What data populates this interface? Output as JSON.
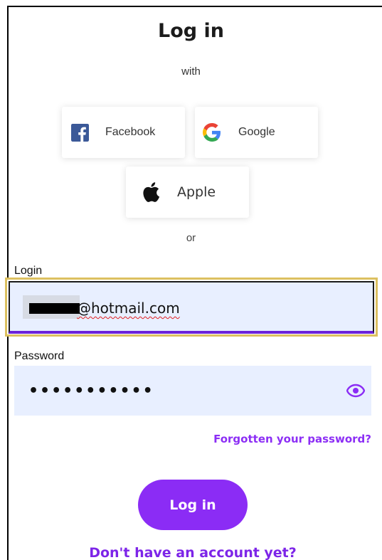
{
  "title": "Log in",
  "with_label": "with",
  "social": {
    "facebook_label": "Facebook",
    "google_label": "Google",
    "apple_label": "Apple"
  },
  "or_label": "or",
  "login": {
    "label": "Login",
    "value": "@hotmail.com"
  },
  "password": {
    "label": "Password",
    "masked_value": "•••••••••••"
  },
  "forgot_link": "Forgotten your password?",
  "login_button": "Log in",
  "signup_link": "Don't have an account yet?",
  "colors": {
    "accent": "#8b2cf5",
    "input_bg": "#e8efff",
    "focus_border": "#dcc060",
    "facebook": "#3b5998"
  },
  "icons": {
    "facebook": "facebook-icon",
    "google": "google-icon",
    "apple": "apple-icon",
    "show_password": "eye-icon"
  }
}
